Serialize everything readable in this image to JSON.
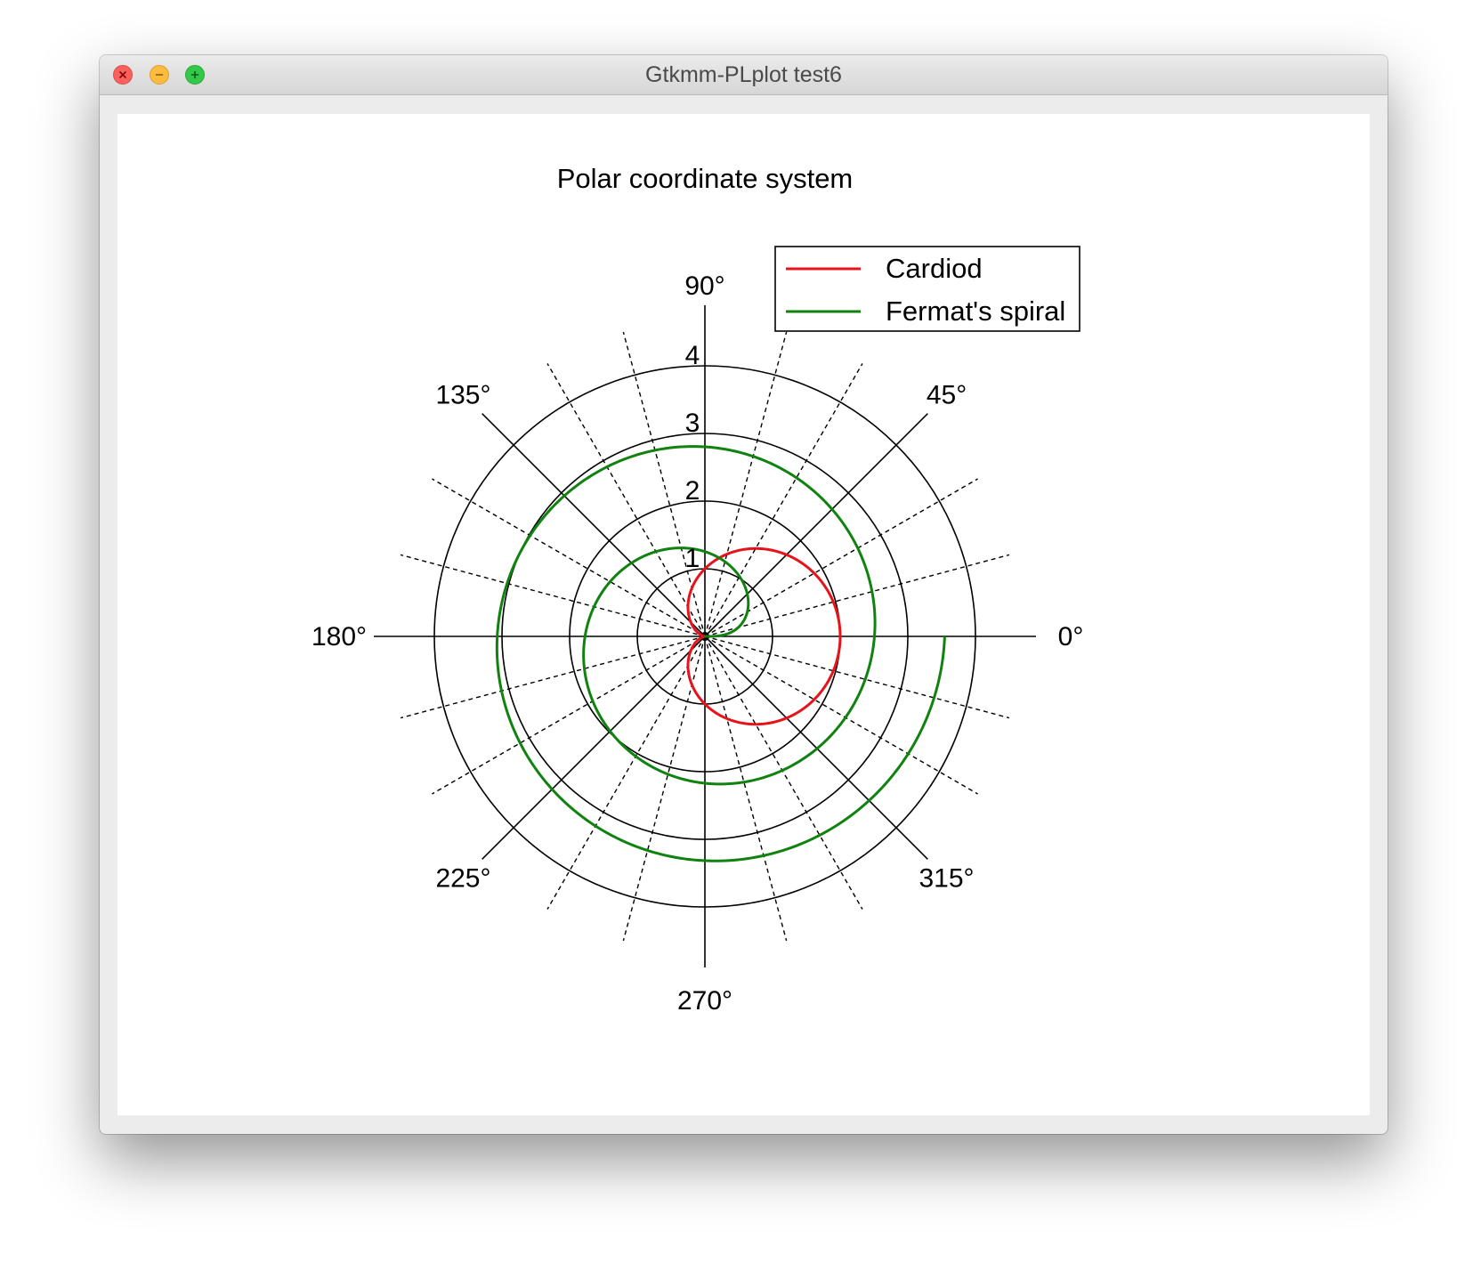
{
  "window": {
    "title": "Gtkmm-PLplot test6",
    "controls": [
      "close",
      "minimize",
      "maximize"
    ]
  },
  "chart_data": {
    "type": "line",
    "coordinate_system": "polar",
    "title": "Polar coordinate system",
    "r_ticks": [
      1,
      2,
      3,
      4
    ],
    "r_max": 4,
    "angle_labels": [
      {
        "deg": 0,
        "text": "0°"
      },
      {
        "deg": 45,
        "text": "45°"
      },
      {
        "deg": 90,
        "text": "90°"
      },
      {
        "deg": 135,
        "text": "135°"
      },
      {
        "deg": 180,
        "text": "180°"
      },
      {
        "deg": 225,
        "text": "225°"
      },
      {
        "deg": 270,
        "text": "270°"
      },
      {
        "deg": 315,
        "text": "315°"
      }
    ],
    "solid_spokes_deg": [
      0,
      45,
      90,
      135,
      180,
      225,
      270,
      315
    ],
    "dashed_spokes_deg": [
      15,
      30,
      60,
      75,
      105,
      120,
      150,
      165,
      195,
      210,
      240,
      255,
      285,
      300,
      330,
      345
    ],
    "legend_position": "top-right",
    "series": [
      {
        "name": "Cardiod",
        "color": "#e8121a",
        "function": "r = 1 + cos(theta)",
        "theta_range_deg": [
          0,
          360
        ],
        "points": [
          {
            "theta": 0,
            "r": 2.0
          },
          {
            "theta": 30,
            "r": 1.87
          },
          {
            "theta": 60,
            "r": 1.5
          },
          {
            "theta": 90,
            "r": 1.0
          },
          {
            "theta": 120,
            "r": 0.5
          },
          {
            "theta": 150,
            "r": 0.13
          },
          {
            "theta": 180,
            "r": 0.0
          },
          {
            "theta": 210,
            "r": 0.13
          },
          {
            "theta": 240,
            "r": 0.5
          },
          {
            "theta": 270,
            "r": 1.0
          },
          {
            "theta": 300,
            "r": 1.5
          },
          {
            "theta": 330,
            "r": 1.87
          },
          {
            "theta": 360,
            "r": 2.0
          }
        ]
      },
      {
        "name": "Fermat's spiral",
        "color": "#0f820f",
        "function": "r = sqrt(theta)",
        "theta_range_rad": [
          0,
          12.566
        ],
        "points": [
          {
            "theta": 0,
            "r": 0.0
          },
          {
            "theta": 90,
            "r": 1.25
          },
          {
            "theta": 180,
            "r": 1.77
          },
          {
            "theta": 270,
            "r": 2.17
          },
          {
            "theta": 360,
            "r": 2.51
          },
          {
            "theta": 450,
            "r": 2.8
          },
          {
            "theta": 540,
            "r": 3.07
          },
          {
            "theta": 630,
            "r": 3.32
          },
          {
            "theta": 720,
            "r": 3.54
          }
        ]
      }
    ]
  }
}
